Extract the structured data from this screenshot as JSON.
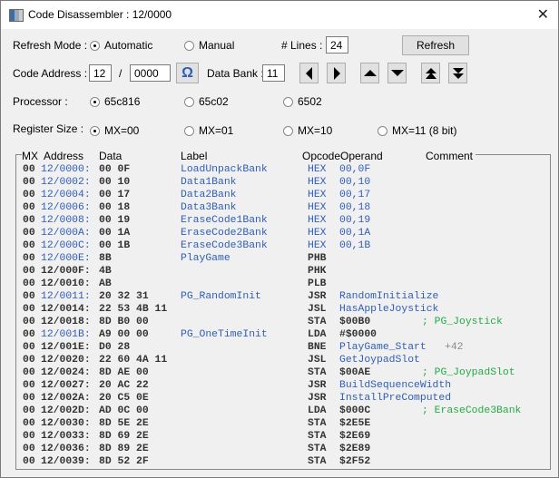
{
  "window": {
    "title": "Code Disassembler : 12/0000",
    "close_icon": "close-icon"
  },
  "refresh": {
    "label": "Refresh Mode :",
    "options": [
      {
        "label": "Automatic",
        "selected": true
      },
      {
        "label": "Manual",
        "selected": false
      }
    ],
    "lines_label": "# Lines :",
    "lines_value": "24",
    "refresh_button": "Refresh"
  },
  "address": {
    "label": "Code Address :",
    "bank": "12",
    "separator": "/",
    "offset": "0000",
    "omega_button": "Ω",
    "data_bank_label": "Data Bank :",
    "data_bank": "11"
  },
  "processor": {
    "label": "Processor :",
    "options": [
      {
        "label": "65c816",
        "selected": true
      },
      {
        "label": "65c02",
        "selected": false
      },
      {
        "label": "6502",
        "selected": false
      }
    ]
  },
  "register": {
    "label": "Register Size :",
    "options": [
      {
        "label": "MX=00",
        "selected": true
      },
      {
        "label": "MX=01",
        "selected": false
      },
      {
        "label": "MX=10",
        "selected": false
      },
      {
        "label": "MX=11  (8 bit)",
        "selected": false
      }
    ]
  },
  "colors": {
    "address_blue": "#2e5db8",
    "comment_green": "#22aa44",
    "text_dark": "#333333"
  },
  "listing": {
    "headers": {
      "mx": "MX",
      "address": "Address",
      "data": "Data",
      "label": "Label",
      "opcode": "Opcode",
      "operand": "Operand",
      "comment": "Comment"
    },
    "rows": [
      {
        "mx": "00",
        "addr": "12/0000:",
        "data": "00 0F",
        "label": "LoadUnpackBank",
        "op": "HEX",
        "oper": "00,0F",
        "cmt": "",
        "blue": true
      },
      {
        "mx": "00",
        "addr": "12/0002:",
        "data": "00 10",
        "label": "Data1Bank",
        "op": "HEX",
        "oper": "00,10",
        "cmt": "",
        "blue": true
      },
      {
        "mx": "00",
        "addr": "12/0004:",
        "data": "00 17",
        "label": "Data2Bank",
        "op": "HEX",
        "oper": "00,17",
        "cmt": "",
        "blue": true
      },
      {
        "mx": "00",
        "addr": "12/0006:",
        "data": "00 18",
        "label": "Data3Bank",
        "op": "HEX",
        "oper": "00,18",
        "cmt": "",
        "blue": true
      },
      {
        "mx": "00",
        "addr": "12/0008:",
        "data": "00 19",
        "label": "EraseCode1Bank",
        "op": "HEX",
        "oper": "00,19",
        "cmt": "",
        "blue": true
      },
      {
        "mx": "00",
        "addr": "12/000A:",
        "data": "00 1A",
        "label": "EraseCode2Bank",
        "op": "HEX",
        "oper": "00,1A",
        "cmt": "",
        "blue": true
      },
      {
        "mx": "00",
        "addr": "12/000C:",
        "data": "00 1B",
        "label": "EraseCode3Bank",
        "op": "HEX",
        "oper": "00,1B",
        "cmt": "",
        "blue": true
      },
      {
        "mx": "00",
        "addr": "12/000E:",
        "data": "8B",
        "label": "PlayGame",
        "op": "PHB",
        "oper": "",
        "cmt": "",
        "addrBlue": true
      },
      {
        "mx": "00",
        "addr": "12/000F:",
        "data": "4B",
        "label": "",
        "op": "PHK",
        "oper": "",
        "cmt": ""
      },
      {
        "mx": "00",
        "addr": "12/0010:",
        "data": "AB",
        "label": "",
        "op": "PLB",
        "oper": "",
        "cmt": ""
      },
      {
        "mx": "00",
        "addr": "12/0011:",
        "data": "20 32 31",
        "label": "PG_RandomInit",
        "op": "JSR",
        "oper": "RandomInitialize",
        "cmt": "",
        "addrBlue": true,
        "operBlue": true
      },
      {
        "mx": "00",
        "addr": "12/0014:",
        "data": "22 53 4B 11",
        "label": "",
        "op": "JSL",
        "oper": "HasAppleJoystick",
        "cmt": "",
        "operBlue": true
      },
      {
        "mx": "00",
        "addr": "12/0018:",
        "data": "8D B0 00",
        "label": "",
        "op": "STA",
        "oper": "$00B0",
        "cmt": "; PG_Joystick"
      },
      {
        "mx": "00",
        "addr": "12/001B:",
        "data": "A9 00 00",
        "label": "PG_OneTimeInit",
        "op": "LDA",
        "oper": "#$0000",
        "cmt": "",
        "addrBlue": true
      },
      {
        "mx": "00",
        "addr": "12/001E:",
        "data": "D0 28",
        "label": "",
        "op": "BNE",
        "oper": "PlayGame_Start",
        "extra": "+42",
        "cmt": "",
        "operBlue": true
      },
      {
        "mx": "00",
        "addr": "12/0020:",
        "data": "22 60 4A 11",
        "label": "",
        "op": "JSL",
        "oper": "GetJoypadSlot",
        "cmt": "",
        "operBlue": true
      },
      {
        "mx": "00",
        "addr": "12/0024:",
        "data": "8D AE 00",
        "label": "",
        "op": "STA",
        "oper": "$00AE",
        "cmt": "; PG_JoypadSlot"
      },
      {
        "mx": "00",
        "addr": "12/0027:",
        "data": "20 AC 22",
        "label": "",
        "op": "JSR",
        "oper": "BuildSequenceWidth",
        "cmt": "",
        "operBlue": true
      },
      {
        "mx": "00",
        "addr": "12/002A:",
        "data": "20 C5 0E",
        "label": "",
        "op": "JSR",
        "oper": "InstallPreComputed",
        "cmt": "",
        "operBlue": true
      },
      {
        "mx": "00",
        "addr": "12/002D:",
        "data": "AD 0C 00",
        "label": "",
        "op": "LDA",
        "oper": "$000C",
        "cmt": "; EraseCode3Bank"
      },
      {
        "mx": "00",
        "addr": "12/0030:",
        "data": "8D 5E 2E",
        "label": "",
        "op": "STA",
        "oper": "$2E5E",
        "cmt": ""
      },
      {
        "mx": "00",
        "addr": "12/0033:",
        "data": "8D 69 2E",
        "label": "",
        "op": "STA",
        "oper": "$2E69",
        "cmt": ""
      },
      {
        "mx": "00",
        "addr": "12/0036:",
        "data": "8D 89 2E",
        "label": "",
        "op": "STA",
        "oper": "$2E89",
        "cmt": ""
      },
      {
        "mx": "00",
        "addr": "12/0039:",
        "data": "8D 52 2F",
        "label": "",
        "op": "STA",
        "oper": "$2F52",
        "cmt": ""
      }
    ]
  }
}
